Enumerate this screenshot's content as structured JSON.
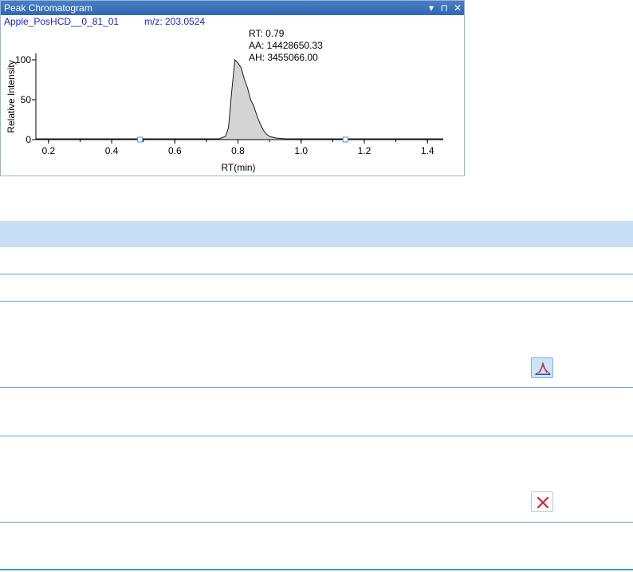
{
  "panel": {
    "title": "Peak Chromatogram",
    "controls": {
      "dropdown": "▾",
      "pin": "⊓",
      "close": "✕"
    }
  },
  "chart_data": {
    "type": "area",
    "sample_label": "Apple_PosHCD__0_81_01",
    "mz_label": "m/z: 203.0524",
    "xlabel": "RT(min)",
    "ylabel": "Relative Intensity",
    "xlim": [
      0.16,
      1.45
    ],
    "ylim": [
      0,
      100
    ],
    "xticks": [
      "0.2",
      "0.4",
      "0.6",
      "0.8",
      "1.0",
      "1.2",
      "1.4"
    ],
    "yticks": [
      "0",
      "50",
      "100"
    ],
    "annotations": [
      "RT: 0.79",
      "AA: 14428650.33",
      "AH: 3455066.00"
    ],
    "boundary_markers_rt": [
      0.49,
      1.14
    ],
    "x": [
      0.16,
      0.74,
      0.76,
      0.77,
      0.78,
      0.79,
      0.8,
      0.81,
      0.82,
      0.83,
      0.84,
      0.85,
      0.86,
      0.87,
      0.88,
      0.89,
      0.9,
      0.92,
      0.95,
      1.0,
      1.05,
      1.45
    ],
    "y": [
      1,
      1,
      4,
      15,
      60,
      100,
      96,
      90,
      76,
      65,
      50,
      42,
      30,
      20,
      12,
      7,
      4,
      2,
      1,
      1,
      1,
      1
    ],
    "fill_color": "#d4d4d4",
    "line_color": "#1a1a1a",
    "label_color": "#1a22d6"
  },
  "table": {
    "header_color": "#c7dff4",
    "line_color": "#5d9fd8",
    "rows": [
      {
        "button": null
      },
      {
        "button": null
      },
      {
        "button": "peak-icon"
      },
      {
        "button": null
      },
      {
        "button": "delete-icon"
      },
      {
        "button": null
      }
    ]
  }
}
